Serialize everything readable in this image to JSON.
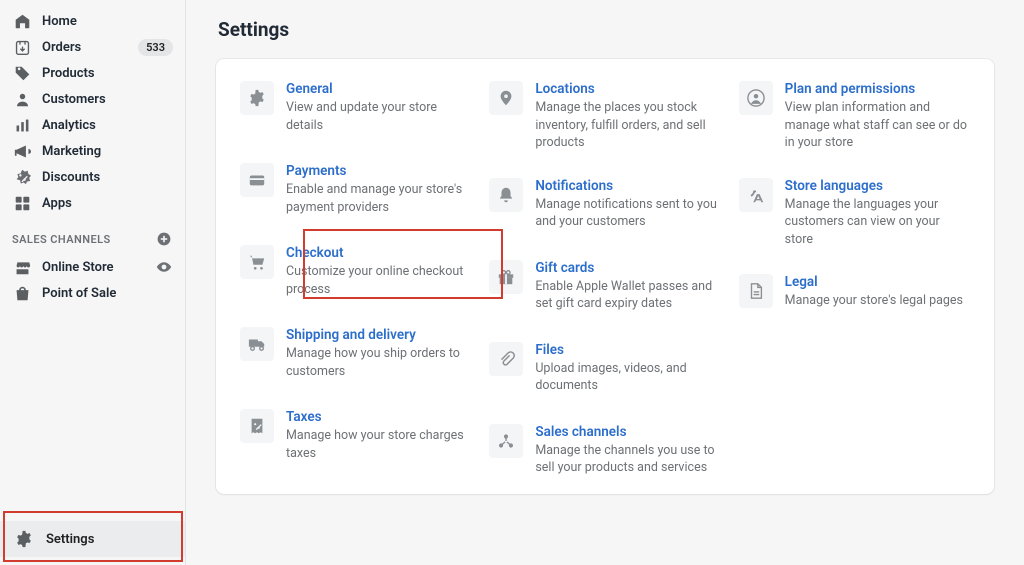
{
  "sidebar": {
    "nav": [
      {
        "icon": "home",
        "label": "Home",
        "badge": ""
      },
      {
        "icon": "orders",
        "label": "Orders",
        "badge": "533"
      },
      {
        "icon": "tag",
        "label": "Products",
        "badge": ""
      },
      {
        "icon": "user",
        "label": "Customers",
        "badge": ""
      },
      {
        "icon": "bars",
        "label": "Analytics",
        "badge": ""
      },
      {
        "icon": "megaphone",
        "label": "Marketing",
        "badge": ""
      },
      {
        "icon": "percent",
        "label": "Discounts",
        "badge": ""
      },
      {
        "icon": "grid",
        "label": "Apps",
        "badge": ""
      }
    ],
    "section_title": "SALES CHANNELS",
    "channels": [
      {
        "icon": "storefront",
        "label": "Online Store",
        "trailing": "eye"
      },
      {
        "icon": "bag",
        "label": "Point of Sale",
        "trailing": ""
      }
    ],
    "settings_label": "Settings"
  },
  "page": {
    "title": "Settings"
  },
  "tiles": {
    "col1": [
      {
        "icon": "gear",
        "title": "General",
        "desc": "View and update your store details"
      },
      {
        "icon": "card",
        "title": "Payments",
        "desc": "Enable and manage your store's payment providers"
      },
      {
        "icon": "cart",
        "title": "Checkout",
        "desc": "Customize your online checkout process"
      },
      {
        "icon": "truck",
        "title": "Shipping and delivery",
        "desc": "Manage how you ship orders to customers"
      },
      {
        "icon": "receipt",
        "title": "Taxes",
        "desc": "Manage how your store charges taxes"
      }
    ],
    "col2": [
      {
        "icon": "pin",
        "title": "Locations",
        "desc": "Manage the places you stock inventory, fulfill orders, and sell products"
      },
      {
        "icon": "bell",
        "title": "Notifications",
        "desc": "Manage notifications sent to you and your customers"
      },
      {
        "icon": "gift",
        "title": "Gift cards",
        "desc": "Enable Apple Wallet passes and set gift card expiry dates"
      },
      {
        "icon": "clip",
        "title": "Files",
        "desc": "Upload images, videos, and documents"
      },
      {
        "icon": "network",
        "title": "Sales channels",
        "desc": "Manage the channels you use to sell your products and services"
      }
    ],
    "col3": [
      {
        "icon": "person-circle",
        "title": "Plan and permissions",
        "desc": "View plan information and manage what staff can see or do in your store"
      },
      {
        "icon": "translate",
        "title": "Store languages",
        "desc": "Manage the languages your customers can view on your store"
      },
      {
        "icon": "doc",
        "title": "Legal",
        "desc": "Manage your store's legal pages"
      }
    ]
  }
}
